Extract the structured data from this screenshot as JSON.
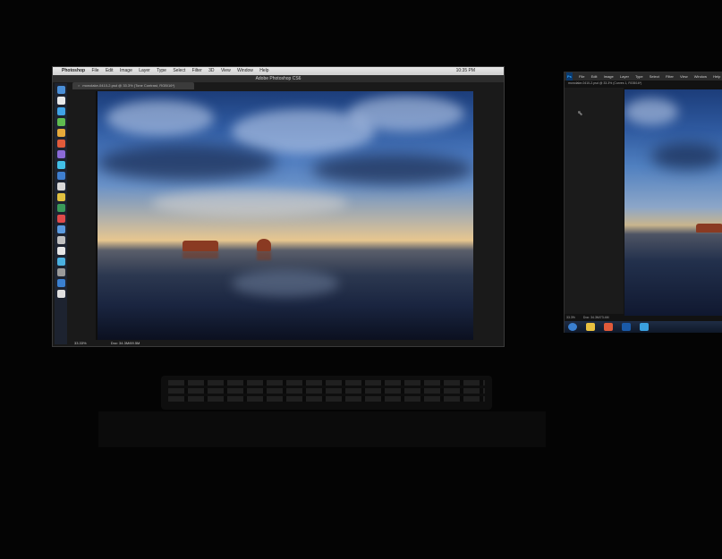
{
  "mac": {
    "apple": "",
    "app": "Photoshop",
    "menus": [
      "File",
      "Edit",
      "Image",
      "Layer",
      "Type",
      "Select",
      "Filter",
      "3D",
      "View",
      "Window",
      "Help"
    ],
    "clock": "10:35 PM",
    "window_title": "Adobe Photoshop CS6",
    "doc_tab": "monolake-0410-2.psd @ 33.3% (Tone Contrast, RGB/16*)",
    "zoom": "33.33%",
    "doc_size": "Doc: 34.3M/69.5M",
    "dock_colors": [
      "#4a8fd8",
      "#e9e9e9",
      "#3fa2e6",
      "#5fbb4f",
      "#e6a93a",
      "#e05a3a",
      "#8b6ad8",
      "#42c0e8",
      "#3f7fd0",
      "#d8d8d8",
      "#e0c040",
      "#3a9a5a",
      "#e04a4a",
      "#5a9ae0",
      "#c0c0c0",
      "#e6e6e6",
      "#4ab0e0",
      "#9a9a9a",
      "#3a80d0",
      "#e0e0e0"
    ]
  },
  "win": {
    "logo": "Ps",
    "menus": [
      "File",
      "Edit",
      "Image",
      "Layer",
      "Type",
      "Select",
      "Filter",
      "View",
      "Window",
      "Help"
    ],
    "doc_tab": "monolake-0410-2.psd @ 33.3% (Curves 1, RGB/16*)",
    "zoom": "33.3%",
    "doc_size": "Doc: 34.3M/73.4M",
    "taskbar_colors": [
      "#3a7fd0",
      "#e8c040",
      "#e05a3a",
      "#1a5aa8",
      "#3aa0e0"
    ]
  }
}
